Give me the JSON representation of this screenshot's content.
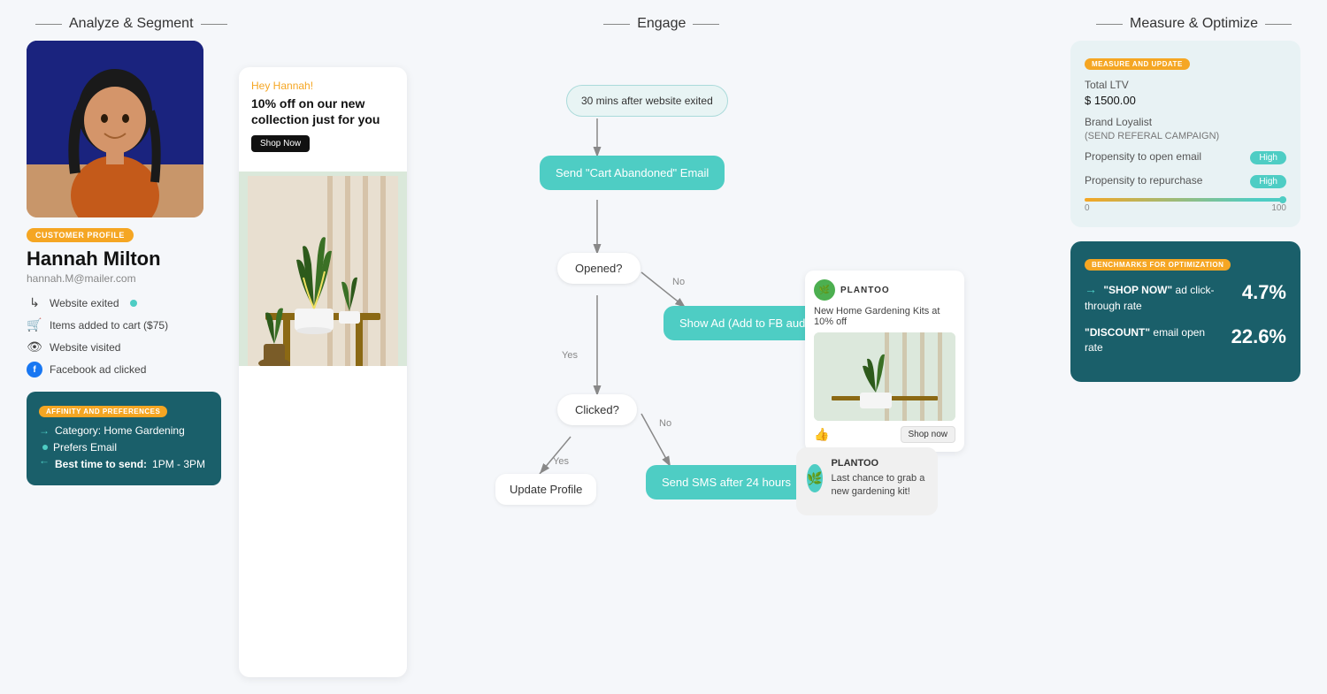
{
  "phases": {
    "analyze": "Analyze & Segment",
    "engage": "Engage",
    "measure": "Measure & Optimize"
  },
  "customer": {
    "profile_badge": "CUSTOMER PROFILE",
    "name": "Hannah Milton",
    "email": "hannah.M@mailer.com",
    "activities": [
      {
        "icon": "↳",
        "label": "Website exited",
        "dot": true
      },
      {
        "icon": "🛒",
        "label": "Items added to cart ($75)",
        "dot": false
      },
      {
        "icon": "👁",
        "label": "Website visited",
        "dot": false
      },
      {
        "icon": "f",
        "label": "Facebook ad clicked",
        "dot": false
      }
    ]
  },
  "affinity": {
    "badge": "AFFINITY AND PREFERENCES",
    "category": "Category: Home Gardening",
    "prefers": "Prefers Email",
    "best_time_label": "Best time to send:",
    "best_time_value": "1PM - 3PM"
  },
  "email_ad": {
    "greeting": "Hey Hannah!",
    "headline": "10% off on our new collection just for you",
    "cta": "Shop Now"
  },
  "flow": {
    "trigger": "30 mins after website exited",
    "send_email": "Send \"Cart Abandoned\" Email",
    "opened_q": "Opened?",
    "show_ad": "Show Ad (Add to FB audience)",
    "clicked_q": "Clicked?",
    "update_profile": "Update Profile",
    "send_sms": "Send SMS after 24 hours",
    "no_label": "No",
    "yes_label": "Yes"
  },
  "fb_ad": {
    "brand": "PLANTOO",
    "text": "New Home Gardening Kits at 10% off",
    "cta": "Shop now"
  },
  "sms": {
    "brand": "PLANTOO",
    "text": "Last chance to grab a new gardening kit!"
  },
  "measure": {
    "badge": "MEASURE AND UPDATE",
    "ltv_label": "Total LTV",
    "ltv_value": "$ 1500.00",
    "brand_label": "Brand Loyalist",
    "brand_value": "(SEND REFERAL CAMPAIGN)",
    "email_label": "Propensity to open email",
    "email_value": "High",
    "repurchase_label": "Propensity to repurchase",
    "repurchase_value": "High",
    "progress_min": "0",
    "progress_max": "100"
  },
  "benchmarks": {
    "badge": "BENCHMARKS FOR OPTIMIZATION",
    "ad_label_strong": "\"SHOP NOW\"",
    "ad_label": " ad click-through rate",
    "ad_value": "4.7%",
    "email_label_strong": "\"DISCOUNT\"",
    "email_label": " email open rate",
    "email_value": "22.6%"
  }
}
